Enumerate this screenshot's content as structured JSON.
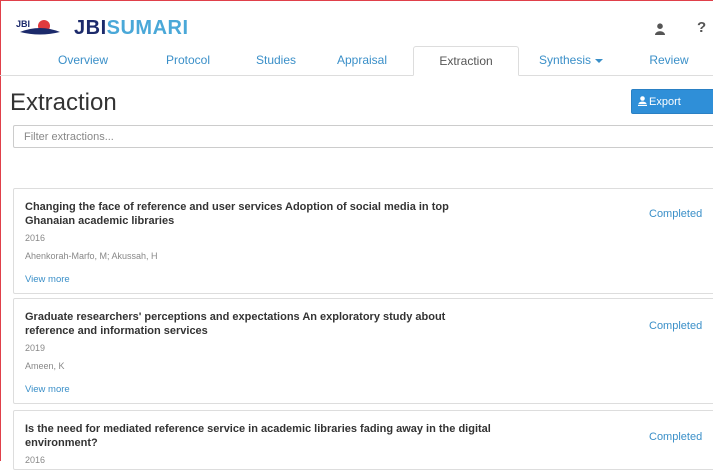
{
  "app": {
    "logo_small": "JBI",
    "brand_jbi": "JBI",
    "brand_sumari": "SUMARI",
    "help_label": "?"
  },
  "tabs": [
    {
      "label": "Overview",
      "active": false
    },
    {
      "label": "Protocol",
      "active": false
    },
    {
      "label": "Studies",
      "active": false
    },
    {
      "label": "Appraisal",
      "active": false
    },
    {
      "label": "Extraction",
      "active": true
    },
    {
      "label": "Synthesis",
      "active": false,
      "dropdown": true
    },
    {
      "label": "Review",
      "active": false
    }
  ],
  "page": {
    "title": "Extraction",
    "export_label": "Export DOCX",
    "filter_placeholder": "Filter extractions..."
  },
  "extractions": [
    {
      "title": "Changing the face of reference and user services Adoption of social media in top Ghanaian academic libraries",
      "year": "2016",
      "authors": "Ahenkorah-Marfo, M; Akussah, H",
      "more_label": "View more",
      "status": "Completed"
    },
    {
      "title": "Graduate researchers' perceptions and expectations An exploratory study about reference and information services",
      "year": "2019",
      "authors": "Ameen, K",
      "more_label": "View more",
      "status": "Completed"
    },
    {
      "title": "Is the need for mediated reference service in academic libraries fading away in the digital environment?",
      "year": "2016",
      "status": "Completed"
    }
  ],
  "colors": {
    "accent": "#3a8fc8",
    "brand_navy": "#1c2a6b",
    "brand_light": "#4aa8d8",
    "brand_red": "#e03a3e",
    "button_primary": "#2f8fd8"
  }
}
